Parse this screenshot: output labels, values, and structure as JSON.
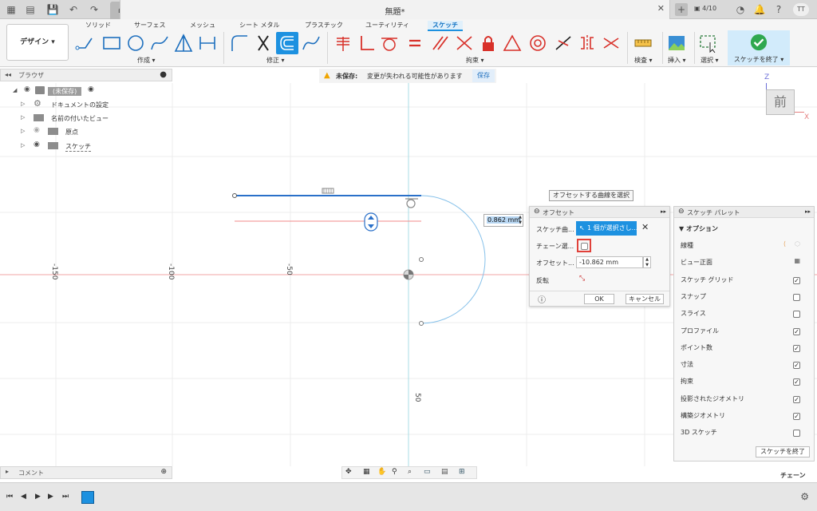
{
  "titlebar": {
    "doc_title": "無題*",
    "job_count": "4/10",
    "user_initials": "TT"
  },
  "ribbon": {
    "design_label": "デザイン ▾",
    "tabs": [
      "ソリッド",
      "サーフェス",
      "メッシュ",
      "シート メタル",
      "プラスチック",
      "ユーティリティ",
      "スケッチ"
    ],
    "groups": {
      "create": "作成 ▾",
      "modify": "修正 ▾",
      "constraints": "拘束 ▾",
      "inspect": "検査 ▾",
      "insert": "挿入 ▾",
      "select": "選択 ▾"
    },
    "finish_sketch": "スケッチを終了 ▾",
    "accent": "#1d91e0"
  },
  "browser": {
    "title": "ブラウザ",
    "items": [
      {
        "label": "(未保存)"
      },
      {
        "label": "ドキュメントの設定"
      },
      {
        "label": "名前の付いたビュー"
      },
      {
        "label": "原点"
      },
      {
        "label": "スケッチ"
      }
    ]
  },
  "warning": {
    "head": "未保存:",
    "message": "変更が失われる可能性があります",
    "save": "保存"
  },
  "viewcube": {
    "front": "前",
    "axis_z": "Z",
    "axis_x": "X"
  },
  "canvas": {
    "ruler_labels": [
      "-150",
      "-100",
      "-50",
      "50"
    ],
    "dim_value": "0.862 mm"
  },
  "tooltip": "オフセットする曲線を選択",
  "offset_dialog": {
    "title": "オフセット",
    "sketch_curve_label": "スケッチ曲...",
    "sketch_curve_value": "1 個が選択さし...",
    "chain_label": "チェーン選...",
    "offset_label": "オフセット...",
    "offset_value": "-10.862 mm",
    "flip_label": "反転",
    "ok": "OK",
    "cancel": "キャンセル"
  },
  "palette": {
    "title": "スケッチ パレット",
    "section": "オプション",
    "rows": [
      {
        "label": "線種",
        "type": "icon"
      },
      {
        "label": "ビュー正面",
        "type": "icon"
      },
      {
        "label": "スケッチ グリッド",
        "checked": true
      },
      {
        "label": "スナップ",
        "checked": false
      },
      {
        "label": "スライス",
        "checked": false
      },
      {
        "label": "プロファイル",
        "checked": true
      },
      {
        "label": "ポイント数",
        "checked": true
      },
      {
        "label": "寸法",
        "checked": true
      },
      {
        "label": "拘束",
        "checked": true
      },
      {
        "label": "投影されたジオメトリ",
        "checked": true
      },
      {
        "label": "構築ジオメトリ",
        "checked": true
      },
      {
        "label": "3D スケッチ",
        "checked": false
      }
    ],
    "finish_button": "スケッチを終了"
  },
  "comment": {
    "label": "コメント"
  },
  "status": {
    "chain": "チェーン"
  }
}
